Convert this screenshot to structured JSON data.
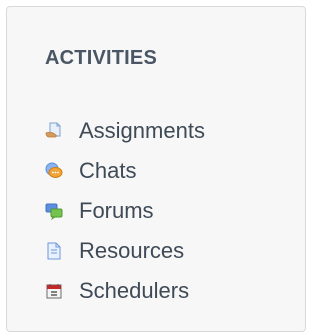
{
  "block": {
    "title": "ACTIVITIES"
  },
  "activities": [
    {
      "label": "Assignments",
      "icon": "assignment-icon"
    },
    {
      "label": "Chats",
      "icon": "chat-icon"
    },
    {
      "label": "Forums",
      "icon": "forum-icon"
    },
    {
      "label": "Resources",
      "icon": "resource-icon"
    },
    {
      "label": "Schedulers",
      "icon": "scheduler-icon"
    }
  ],
  "colors": {
    "title": "#4a5664",
    "text": "#3f4a57",
    "block_background": "#f7f7f7",
    "block_border": "#d9d9d9"
  }
}
